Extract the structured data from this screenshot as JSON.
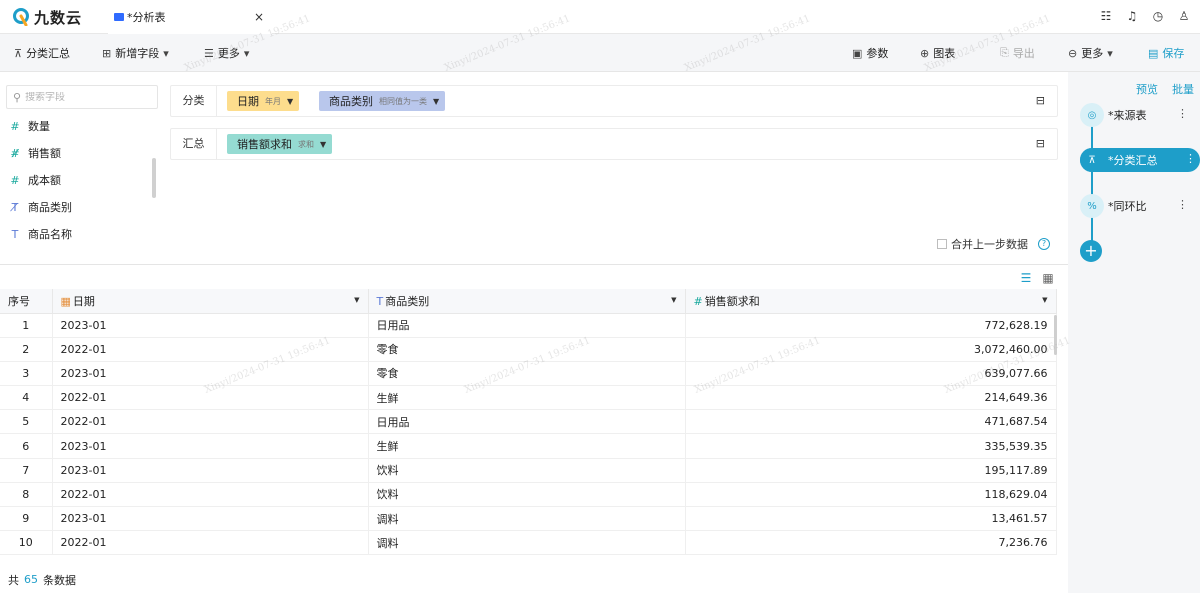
{
  "app": {
    "logo_text": "九数云"
  },
  "tab": {
    "title": "*分析表",
    "close": "×"
  },
  "top_icons": [
    "list-icon",
    "bell-icon",
    "timer-icon",
    "user-icon"
  ],
  "toolbar": {
    "group_summary": "分类汇总",
    "add_field": "新增字段",
    "more_left": "更多",
    "params": "参数",
    "chart": "图表",
    "export": "导出",
    "more_right": "更多",
    "save": "保存"
  },
  "fields": {
    "search_placeholder": "搜索字段",
    "items": [
      {
        "label": "数量",
        "type": "number"
      },
      {
        "label": "销售额",
        "type": "number-computed"
      },
      {
        "label": "成本额",
        "type": "number"
      },
      {
        "label": "商品类别",
        "type": "text-computed"
      },
      {
        "label": "商品名称",
        "type": "text"
      }
    ]
  },
  "config": {
    "classify_label": "分类",
    "classify_chips": [
      {
        "label": "日期",
        "sub": "年月"
      },
      {
        "label": "商品类别",
        "sub": "相同值为一类"
      }
    ],
    "summary_label": "汇总",
    "summary_chips": [
      {
        "label": "销售额求和",
        "sub": "求和"
      }
    ],
    "merge_label": "合并上一步数据",
    "help": "?"
  },
  "right_panel": {
    "preview": "预览",
    "batch": "批量",
    "nodes": [
      {
        "label": "*来源表",
        "active": false
      },
      {
        "label": "*分类汇总",
        "active": true
      },
      {
        "label": "*同环比",
        "active": false
      }
    ],
    "add": "+"
  },
  "table": {
    "headers": [
      "序号",
      "日期",
      "商品类别",
      "销售额求和"
    ],
    "rows": [
      [
        "1",
        "2023-01",
        "日用品",
        "772,628.19"
      ],
      [
        "2",
        "2022-01",
        "零食",
        "3,072,460.00"
      ],
      [
        "3",
        "2023-01",
        "零食",
        "639,077.66"
      ],
      [
        "4",
        "2022-01",
        "生鲜",
        "214,649.36"
      ],
      [
        "5",
        "2022-01",
        "日用品",
        "471,687.54"
      ],
      [
        "6",
        "2023-01",
        "生鲜",
        "335,539.35"
      ],
      [
        "7",
        "2023-01",
        "饮料",
        "195,117.89"
      ],
      [
        "8",
        "2022-01",
        "饮料",
        "118,629.04"
      ],
      [
        "9",
        "2023-01",
        "调料",
        "13,461.57"
      ],
      [
        "10",
        "2022-01",
        "调料",
        "7,236.76"
      ]
    ]
  },
  "footer": {
    "prefix": "共",
    "count": "65",
    "suffix": "条数据"
  },
  "watermark": "Xinyi/2024-07-31 19:56:41",
  "colors": {
    "accent": "#1e9ec9",
    "date_chip": "#fddd8d",
    "text_chip": "#b9c7ec",
    "number_chip": "#95dbd2"
  }
}
